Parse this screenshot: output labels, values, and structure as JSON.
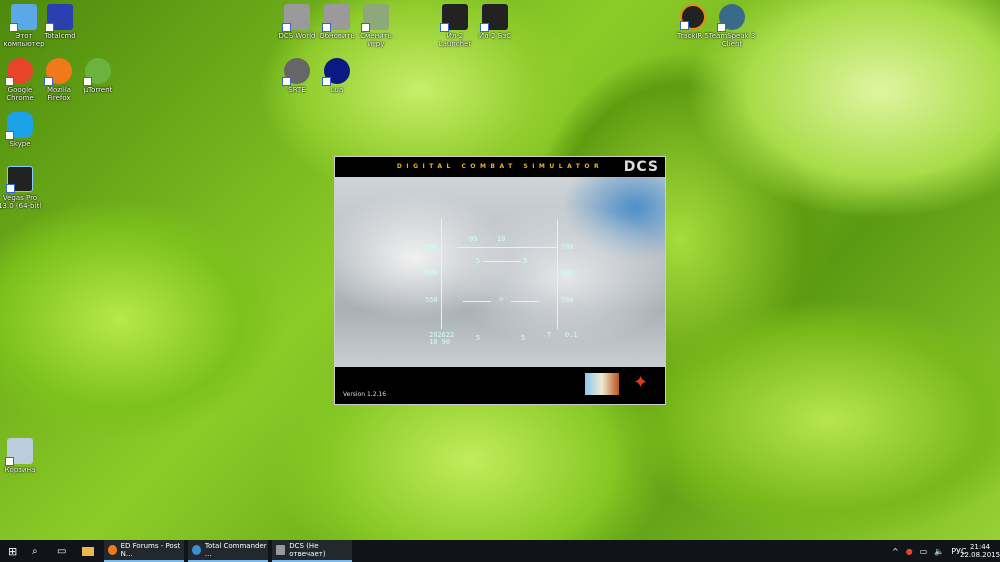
{
  "desktop_icons": [
    {
      "label": "Этот компьютер",
      "color": "#5aa9e6"
    },
    {
      "label": "Totalcmd",
      "color": "#2b3fb0"
    },
    {
      "label": "Google Chrome",
      "color": "#e6452c"
    },
    {
      "label": "Mozilla Firefox",
      "color": "#f07a1a"
    },
    {
      "label": "µTorrent",
      "color": "#6cb33e"
    },
    {
      "label": "Skype",
      "color": "#1aa3e8"
    },
    {
      "label": "Vegas Pro 13.0 (64-bit)",
      "color": "#222"
    },
    {
      "label": "DCS World",
      "color": "#9a9a9a"
    },
    {
      "label": "Обновить",
      "color": "#9a9a9a"
    },
    {
      "label": "Сменить игру",
      "color": "#8fa87a"
    },
    {
      "label": "Ил-2 Launcher",
      "color": "#222"
    },
    {
      "label": "Ил-2 БзС",
      "color": "#222"
    },
    {
      "label": "SRTE",
      "color": "#666"
    },
    {
      "label": "Lua",
      "color": "#0a1a80"
    },
    {
      "label": "TrackIR 5",
      "color": "#222"
    },
    {
      "label": "TeamSpeak 3 Client",
      "color": "#3a6a8a"
    },
    {
      "label": "Корзина",
      "color": "#bcd"
    }
  ],
  "splash": {
    "title": "DIGITAL COMBAT SIMULATOR",
    "logo": "DCS",
    "version": "Version 1.2.16",
    "hud": {
      "heading_09": "09",
      "heading_10": "10",
      "alt_650": "650",
      "alt_600": "600",
      "alt_550": "550",
      "spd_700": "700",
      "spd_600": "600",
      "spd_500": "500",
      "pitch_l": "5",
      "pitch_r": "5",
      "readout1": "202622",
      "readout2": "10 90",
      "bottom_l": "5",
      "bottom_r": "5",
      "t_label": "T",
      "t_value": "0.1"
    }
  },
  "taskbar": {
    "tasks": [
      {
        "label": "ED Forums - Post N...",
        "color": "#f07a1a"
      },
      {
        "label": "Total Commander ...",
        "color": "#3a8fd0"
      },
      {
        "label": "DCS (Не отвечает)",
        "color": "#999"
      }
    ],
    "lang": "РУС",
    "time": "21:44",
    "date": "22.08.2015"
  }
}
